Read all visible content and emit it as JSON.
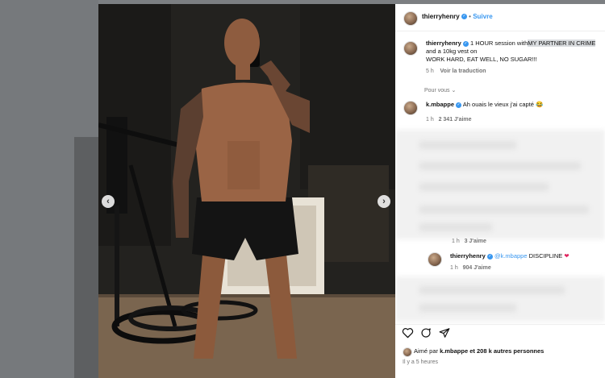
{
  "post": {
    "author": "thierryhenry",
    "follow_label": "Suivre",
    "caption_author": "thierryhenry",
    "caption_line1": "1 HOUR session with",
    "caption_highlight": "MY PARTNER IN CRIME",
    "caption_line2": "and a 10kg vest on",
    "caption_line3": "WORK HARD, EAT WELL, NO SUGAR!!!",
    "caption_time": "5 h",
    "translate_label": "Voir la traduction",
    "for_you_label": "Pour vous"
  },
  "comments": [
    {
      "author": "k.mbappe",
      "text": "Ah ouais le vieux j'ai capté 😂",
      "time": "1 h",
      "likes": "2 341 J'aime"
    },
    {
      "time": "1 h",
      "likes": "3 J'aime"
    },
    {
      "author": "thierryhenry",
      "mention": "@k.mbappe",
      "text": "DISCIPLINE",
      "emoji": "❤",
      "time": "1 h",
      "likes": "904 J'aime"
    }
  ],
  "footer": {
    "liked_by_prefix": "Aimé par",
    "liked_by_user": "k.mbappe",
    "liked_by_rest": "et 208 k autres personnes",
    "posted_time": "Il y a 5 heures"
  },
  "icons": {
    "like": "heart-icon",
    "comment": "comment-icon",
    "share": "send-icon",
    "prev": "chevron-left-icon",
    "next": "chevron-right-icon"
  },
  "colors": {
    "link": "#3897f0",
    "highlight": "#d9dcdf",
    "heart": "#e0245e"
  }
}
